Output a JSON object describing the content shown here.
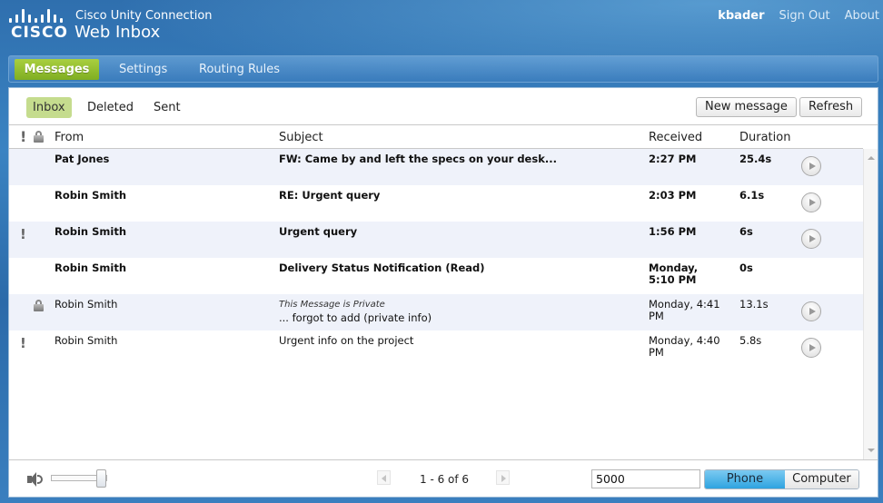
{
  "header": {
    "logo_text": "CISCO",
    "app_subtitle": "Cisco Unity Connection",
    "app_title": "Web Inbox",
    "user": "kbader",
    "sign_out": "Sign Out",
    "about": "About"
  },
  "nav": {
    "tabs": [
      {
        "label": "Messages",
        "active": true
      },
      {
        "label": "Settings",
        "active": false
      },
      {
        "label": "Routing Rules",
        "active": false
      }
    ]
  },
  "toolbar": {
    "folders": [
      {
        "label": "Inbox",
        "active": true
      },
      {
        "label": "Deleted",
        "active": false
      },
      {
        "label": "Sent",
        "active": false
      }
    ],
    "new_message": "New message",
    "refresh": "Refresh"
  },
  "table": {
    "columns": {
      "urgent": "!",
      "private": "lock-icon",
      "from": "From",
      "subject": "Subject",
      "received": "Received",
      "duration": "Duration"
    },
    "rows": [
      {
        "urgent": false,
        "private": false,
        "unread": true,
        "from": "Pat Jones",
        "subject_note": "",
        "subject": "FW: Came by and left the specs on your desk...",
        "received": "2:27 PM",
        "duration": "25.4s",
        "playable": true
      },
      {
        "urgent": false,
        "private": false,
        "unread": true,
        "from": "Robin Smith",
        "subject_note": "",
        "subject": "RE: Urgent query",
        "received": "2:03 PM",
        "duration": "6.1s",
        "playable": true
      },
      {
        "urgent": true,
        "private": false,
        "unread": true,
        "from": "Robin Smith",
        "subject_note": "",
        "subject": "Urgent query",
        "received": "1:56 PM",
        "duration": "6s",
        "playable": true
      },
      {
        "urgent": false,
        "private": false,
        "unread": true,
        "from": "Robin Smith",
        "subject_note": "",
        "subject": "Delivery Status Notification (Read)",
        "received": "Monday,\n5:10 PM",
        "duration": "0s",
        "playable": false
      },
      {
        "urgent": false,
        "private": true,
        "unread": false,
        "from": "Robin Smith",
        "subject_note": "This Message is Private",
        "subject": "... forgot to add (private info)",
        "received": "Monday, 4:41\nPM",
        "duration": "13.1s",
        "playable": true
      },
      {
        "urgent": true,
        "private": false,
        "unread": false,
        "from": "Robin Smith",
        "subject_note": "",
        "subject": "Urgent info on the project",
        "received": "Monday, 4:40\nPM",
        "duration": "5.8s",
        "playable": true
      }
    ]
  },
  "footer": {
    "volume_percent": 88,
    "pager": "1 - 6 of 6",
    "extension_value": "5000",
    "playback_options": [
      {
        "label": "Phone",
        "active": true
      },
      {
        "label": "Computer",
        "active": false
      }
    ]
  },
  "colors": {
    "accent_green": "#8dbb2c",
    "header_blue": "#2f6fae",
    "phone_active_blue": "#2ea3e0",
    "alt_row": "#eff2fa"
  }
}
